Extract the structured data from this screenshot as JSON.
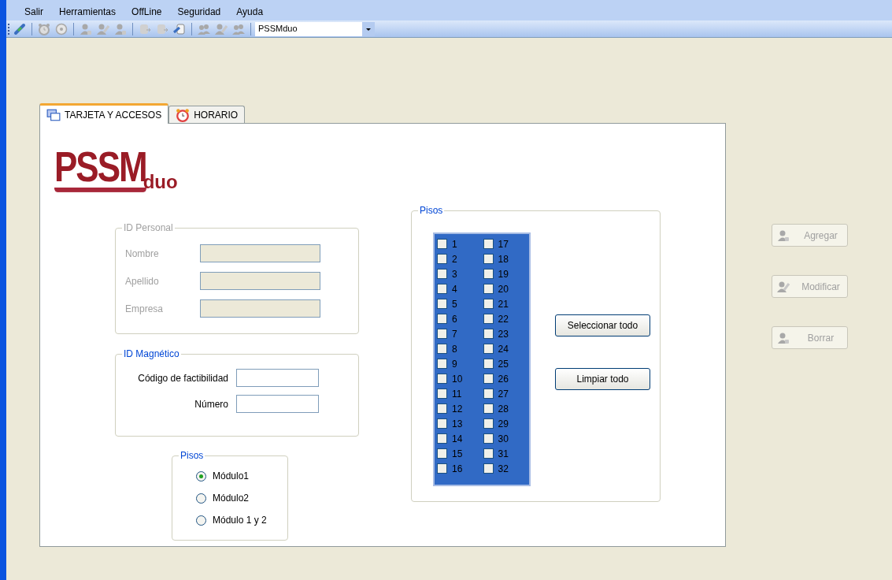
{
  "menu": [
    "Salir",
    "Herramientas",
    "OffLine",
    "Seguridad",
    "Ayuda"
  ],
  "toolbar": {
    "groups": [
      [
        {
          "kind": "plug",
          "disabled": false
        }
      ],
      [
        {
          "kind": "alarm",
          "disabled": true
        },
        {
          "kind": "clock",
          "disabled": true
        }
      ],
      [
        {
          "kind": "person",
          "disabled": true
        },
        {
          "kind": "person-edit",
          "disabled": true
        },
        {
          "kind": "person",
          "disabled": true
        }
      ],
      [
        {
          "kind": "database",
          "disabled": true
        },
        {
          "kind": "database",
          "disabled": true
        },
        {
          "kind": "scroll",
          "disabled": false
        }
      ],
      [
        {
          "kind": "people",
          "disabled": true
        },
        {
          "kind": "person-edit",
          "disabled": true
        },
        {
          "kind": "people",
          "disabled": true
        }
      ]
    ],
    "combo": {
      "value": "PSSMduo"
    }
  },
  "tabs": [
    {
      "label": "TARJETA Y ACCESOS",
      "kind": "card",
      "selected": true
    },
    {
      "label": "HORARIO",
      "kind": "alarm",
      "selected": false
    }
  ],
  "logo": {
    "main": "PSSM",
    "sub": "duo"
  },
  "id_personal": {
    "title": "ID Personal",
    "disabled": true,
    "fields": [
      {
        "label": "Nombre"
      },
      {
        "label": "Apellido"
      },
      {
        "label": "Empresa"
      }
    ]
  },
  "id_magnetico": {
    "title": "ID Magnético",
    "disabled": false,
    "fields": [
      {
        "label": "Código de factibilidad"
      },
      {
        "label": "Número"
      }
    ]
  },
  "modulos": {
    "title": "Pisos",
    "options": [
      {
        "label": "Módulo1",
        "selected": true
      },
      {
        "label": "Módulo2",
        "selected": false
      },
      {
        "label": "Módulo 1 y 2",
        "selected": false
      }
    ]
  },
  "pisos": {
    "title": "Pisos",
    "floors": [
      {
        "label": "1",
        "checked": false
      },
      {
        "label": "2",
        "checked": false
      },
      {
        "label": "3",
        "checked": false
      },
      {
        "label": "4",
        "checked": false
      },
      {
        "label": "5",
        "checked": false
      },
      {
        "label": "6",
        "checked": false
      },
      {
        "label": "7",
        "checked": false
      },
      {
        "label": "8",
        "checked": false
      },
      {
        "label": "9",
        "checked": false
      },
      {
        "label": "10",
        "checked": false
      },
      {
        "label": "11",
        "checked": false
      },
      {
        "label": "12",
        "checked": false
      },
      {
        "label": "13",
        "checked": false
      },
      {
        "label": "14",
        "checked": false
      },
      {
        "label": "15",
        "checked": false
      },
      {
        "label": "16",
        "checked": false
      },
      {
        "label": "17",
        "checked": false
      },
      {
        "label": "18",
        "checked": false
      },
      {
        "label": "19",
        "checked": false
      },
      {
        "label": "20",
        "checked": false
      },
      {
        "label": "21",
        "checked": false
      },
      {
        "label": "22",
        "checked": false
      },
      {
        "label": "23",
        "checked": false
      },
      {
        "label": "24",
        "checked": false
      },
      {
        "label": "25",
        "checked": false
      },
      {
        "label": "26",
        "checked": false
      },
      {
        "label": "27",
        "checked": false
      },
      {
        "label": "28",
        "checked": false
      },
      {
        "label": "29",
        "checked": false
      },
      {
        "label": "30",
        "checked": false
      },
      {
        "label": "31",
        "checked": false
      },
      {
        "label": "32",
        "checked": false
      }
    ],
    "buttons": [
      "Seleccionar todo",
      "Limpiar todo"
    ]
  },
  "actions": [
    {
      "label": "Agregar",
      "kind": "person",
      "disabled": true
    },
    {
      "label": "Modificar",
      "kind": "person-edit",
      "disabled": true
    },
    {
      "label": "Borrar",
      "kind": "person",
      "disabled": true
    }
  ]
}
